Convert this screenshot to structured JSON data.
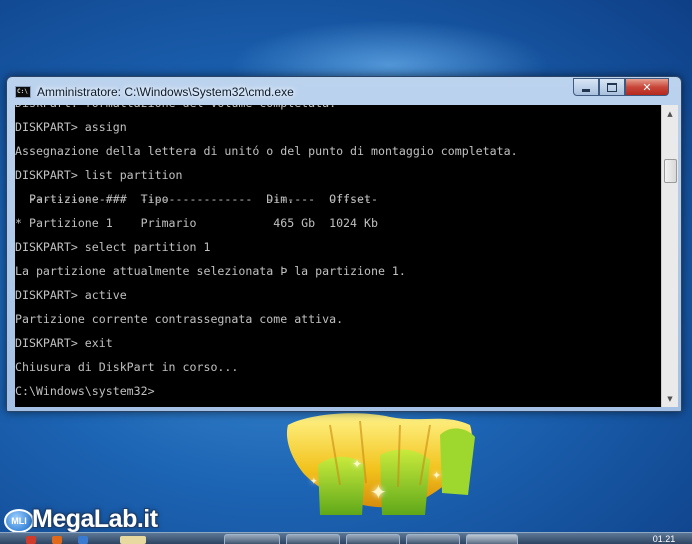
{
  "window": {
    "title": "Amministratore: C:\\Windows\\System32\\cmd.exe",
    "icon_label": "C:\\",
    "minimize_icon": "minimize-icon",
    "maximize_icon": "maximize-icon",
    "close_label": "✕"
  },
  "console": {
    "lines": [
      "DiskPart: formattazione del volume completata.",
      "DISKPART> assign",
      "Assegnazione della lettera di unitó o del punto di montaggio completata.",
      "DISKPART> list partition",
      "  Partizione ###  Tipo              Dim.     Offset",
      "  -------------   ----------------  -------  -------",
      "* Partizione 1    Primario           465 Gb  1024 Kb",
      "DISKPART> select partition 1",
      "La partizione attualmente selezionata Þ la partizione 1.",
      "DISKPART> active",
      "Partizione corrente contrassegnata come attiva.",
      "DISKPART> exit",
      "Chiusura di DiskPart in corso...",
      "C:\\Windows\\system32>"
    ]
  },
  "scrollbar": {
    "up_icon": "▲",
    "down_icon": "▼",
    "position": 0.15
  },
  "watermark": {
    "badge": "MLI",
    "text": "MegaLab.it"
  },
  "taskbar": {
    "clock": "01.21"
  },
  "colors": {
    "console_background": "#000000",
    "console_text": "#c0c0c0",
    "close_button": "#c8473a",
    "desktop": "#1c64b4"
  }
}
